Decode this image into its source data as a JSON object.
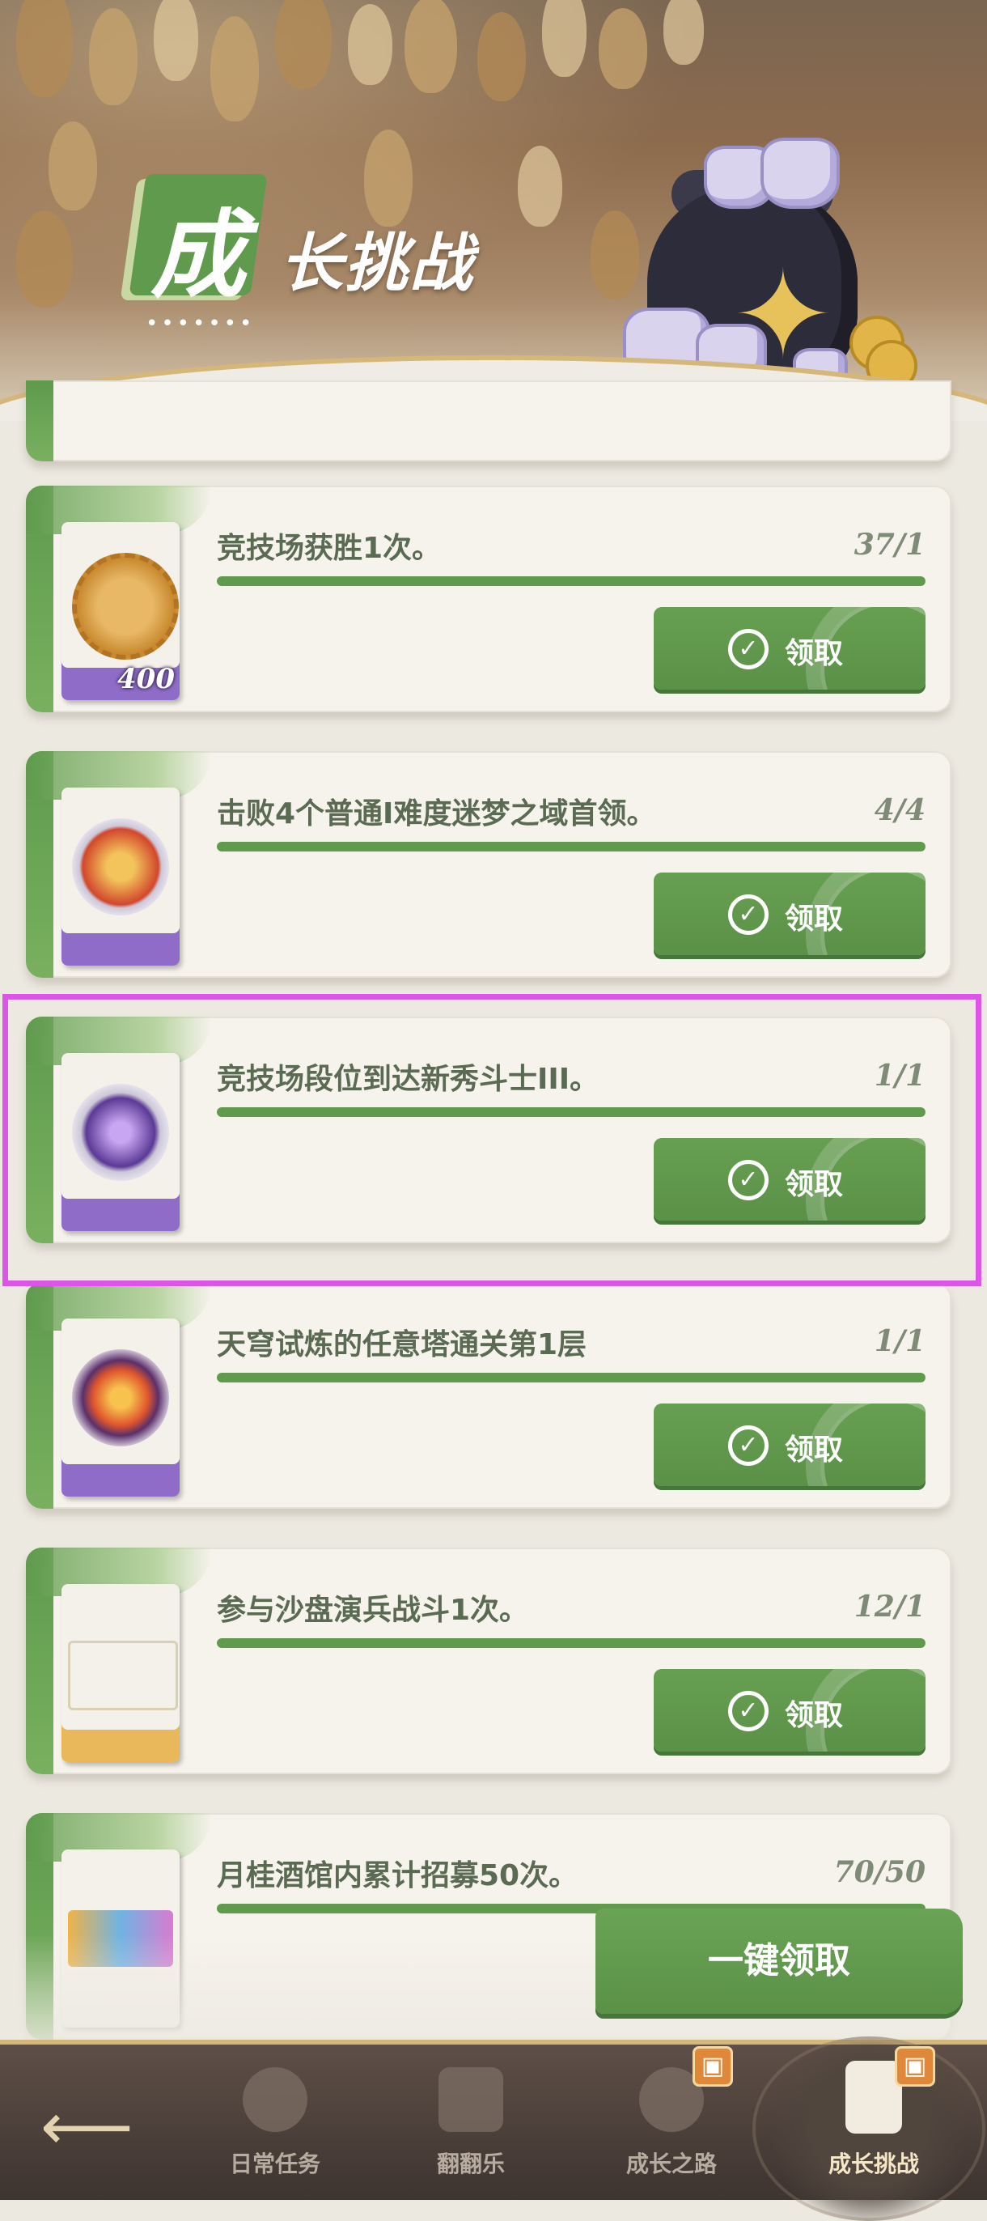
{
  "header": {
    "title_first_char": "成",
    "title_rest": "长挑战",
    "title_dots": "•••••••"
  },
  "tasks": [
    {
      "name": "竞技场获胜1次。",
      "progress": "37/1",
      "reward_count": "400",
      "claim_label": "领取",
      "fill": 1.0
    },
    {
      "name": "击败4个普通Ⅰ难度迷梦之域首领。",
      "progress": "4/4",
      "reward_count": "",
      "claim_label": "领取",
      "fill": 1.0
    },
    {
      "name": "竞技场段位到达新秀斗士III。",
      "progress": "1/1",
      "reward_count": "",
      "claim_label": "领取",
      "fill": 1.0
    },
    {
      "name": "天穹试炼的任意塔通关第1层",
      "progress": "1/1",
      "reward_count": "",
      "claim_label": "领取",
      "fill": 1.0
    },
    {
      "name": "参与沙盘演兵战斗1次。",
      "progress": "12/1",
      "reward_count": "",
      "claim_label": "领取",
      "fill": 1.0
    },
    {
      "name": "月桂酒馆内累计招募50次。",
      "progress": "70/50",
      "reward_count": "",
      "claim_label": "",
      "fill": 1.0
    }
  ],
  "bulk_claim_label": "一键领取",
  "nav": {
    "back_icon": "back-arrow-icon",
    "tabs": [
      {
        "label": "日常任务",
        "icon": "gear-icon",
        "active": false
      },
      {
        "label": "翻翻乐",
        "icon": "card-flip-icon",
        "active": false
      },
      {
        "label": "成长之路",
        "icon": "compass-icon",
        "active": false
      },
      {
        "label": "成长挑战",
        "icon": "scroll-icon",
        "active": true
      }
    ]
  },
  "colors": {
    "accent_green": "#5f9a4d",
    "selection": "#dc55e6",
    "gift_orange": "#e0883a"
  }
}
